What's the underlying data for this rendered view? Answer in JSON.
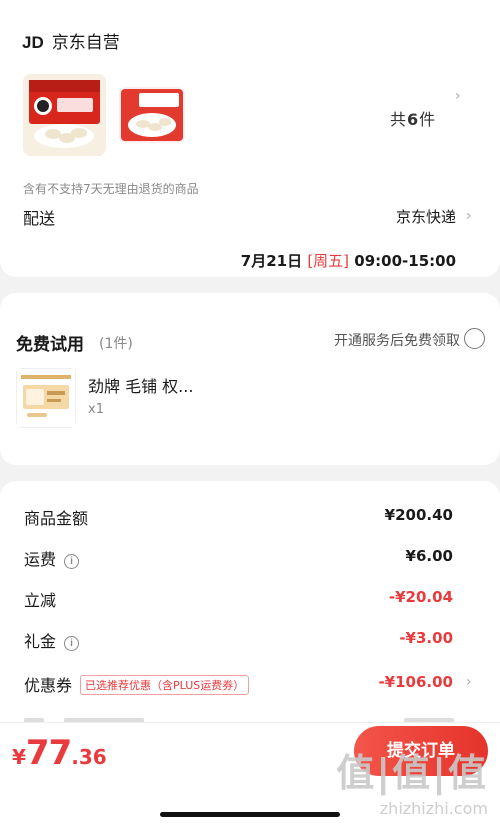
{
  "store": {
    "logo": "JD",
    "name": "京东自营"
  },
  "order": {
    "total_prefix": "共",
    "total_num": "6",
    "total_suffix": "件",
    "return_note": "含有不支持7天无理由退货的商品",
    "delivery_label": "配送",
    "delivery_method": "京东快递",
    "delivery_date": "7月21日",
    "delivery_day": "[周五]",
    "delivery_window": "09:00-15:00"
  },
  "trial": {
    "title": "免费试用",
    "count": "(1件)",
    "cta": "开通服务后免费领取",
    "item_name": "劲牌 毛铺 权...",
    "item_qty": "x1"
  },
  "price": {
    "goods_label": "商品金额",
    "goods_value": "¥200.40",
    "shipping_label": "运费",
    "shipping_value": "¥6.00",
    "discount_label": "立减",
    "discount_value": "-¥20.04",
    "gift_label": "礼金",
    "gift_value": "-¥3.00",
    "coupon_label": "优惠券",
    "coupon_tag": "已选推荐优惠（含PLUS运费券）",
    "coupon_value": "-¥106.00"
  },
  "footer": {
    "currency": "¥",
    "total_int": "77",
    "total_dec": ".36",
    "submit_label": "提交订单"
  },
  "watermark": {
    "big": "值|值|值",
    "small": "zhizhizhi.com"
  },
  "colors": {
    "accent": "#e93b3d",
    "background": "#f2f2f2"
  }
}
